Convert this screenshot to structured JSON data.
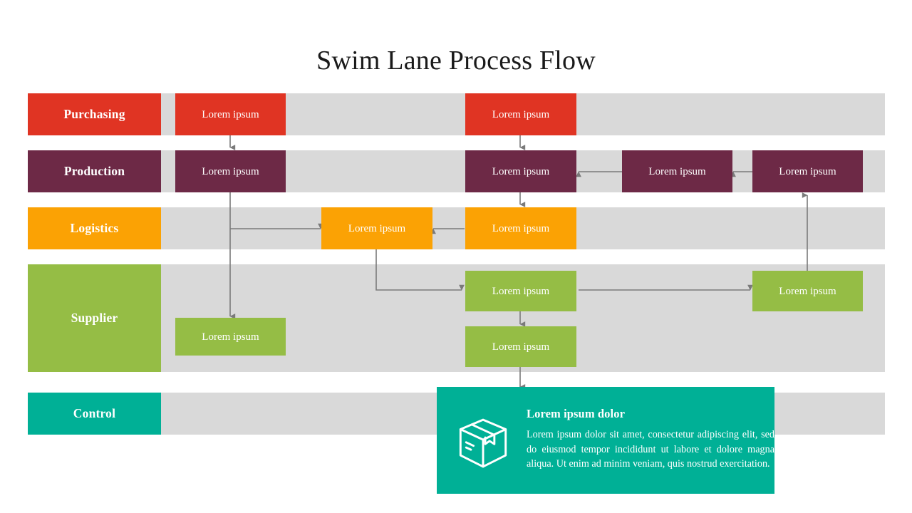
{
  "title": "Swim Lane Process Flow",
  "colors": {
    "background": "#ffffff",
    "lane_band": "#d9d9d9",
    "connector": "#7a7a7a",
    "title_text": "#1a1a1a",
    "purchasing": "#e03423",
    "production": "#6d2946",
    "logistics": "#fba204",
    "supplier": "#95bd45",
    "control": "#00b096",
    "box_text": "#ffffff"
  },
  "lanes": [
    {
      "id": "purchasing",
      "label": "Purchasing",
      "color": "#e03423"
    },
    {
      "id": "production",
      "label": "Production",
      "color": "#6d2946"
    },
    {
      "id": "logistics",
      "label": "Logistics",
      "color": "#fba204"
    },
    {
      "id": "supplier",
      "label": "Supplier",
      "color": "#95bd45"
    },
    {
      "id": "control",
      "label": "Control",
      "color": "#00b096"
    }
  ],
  "process_boxes": [
    {
      "id": "purchasing-1",
      "lane": "purchasing",
      "label": "Lorem ipsum"
    },
    {
      "id": "purchasing-2",
      "lane": "purchasing",
      "label": "Lorem ipsum"
    },
    {
      "id": "production-1",
      "lane": "production",
      "label": "Lorem ipsum"
    },
    {
      "id": "production-2",
      "lane": "production",
      "label": "Lorem ipsum"
    },
    {
      "id": "production-3",
      "lane": "production",
      "label": "Lorem ipsum"
    },
    {
      "id": "production-4",
      "lane": "production",
      "label": "Lorem ipsum"
    },
    {
      "id": "logistics-1",
      "lane": "logistics",
      "label": "Lorem ipsum"
    },
    {
      "id": "logistics-2",
      "lane": "logistics",
      "label": "Lorem ipsum"
    },
    {
      "id": "supplier-1",
      "lane": "supplier",
      "label": "Lorem ipsum"
    },
    {
      "id": "supplier-2",
      "lane": "supplier",
      "label": "Lorem ipsum"
    },
    {
      "id": "supplier-3",
      "lane": "supplier",
      "label": "Lorem ipsum"
    },
    {
      "id": "supplier-4",
      "lane": "supplier",
      "label": "Lorem ipsum"
    }
  ],
  "detail_card": {
    "lane": "control",
    "icon": "package-box-icon",
    "heading": "Lorem ipsum dolor",
    "body": "Lorem ipsum dolor sit amet, consectetur adipiscing elit, sed do eiusmod tempor incididunt ut labore et dolore magna aliqua. Ut enim ad minim veniam, quis nostrud exercitation."
  }
}
